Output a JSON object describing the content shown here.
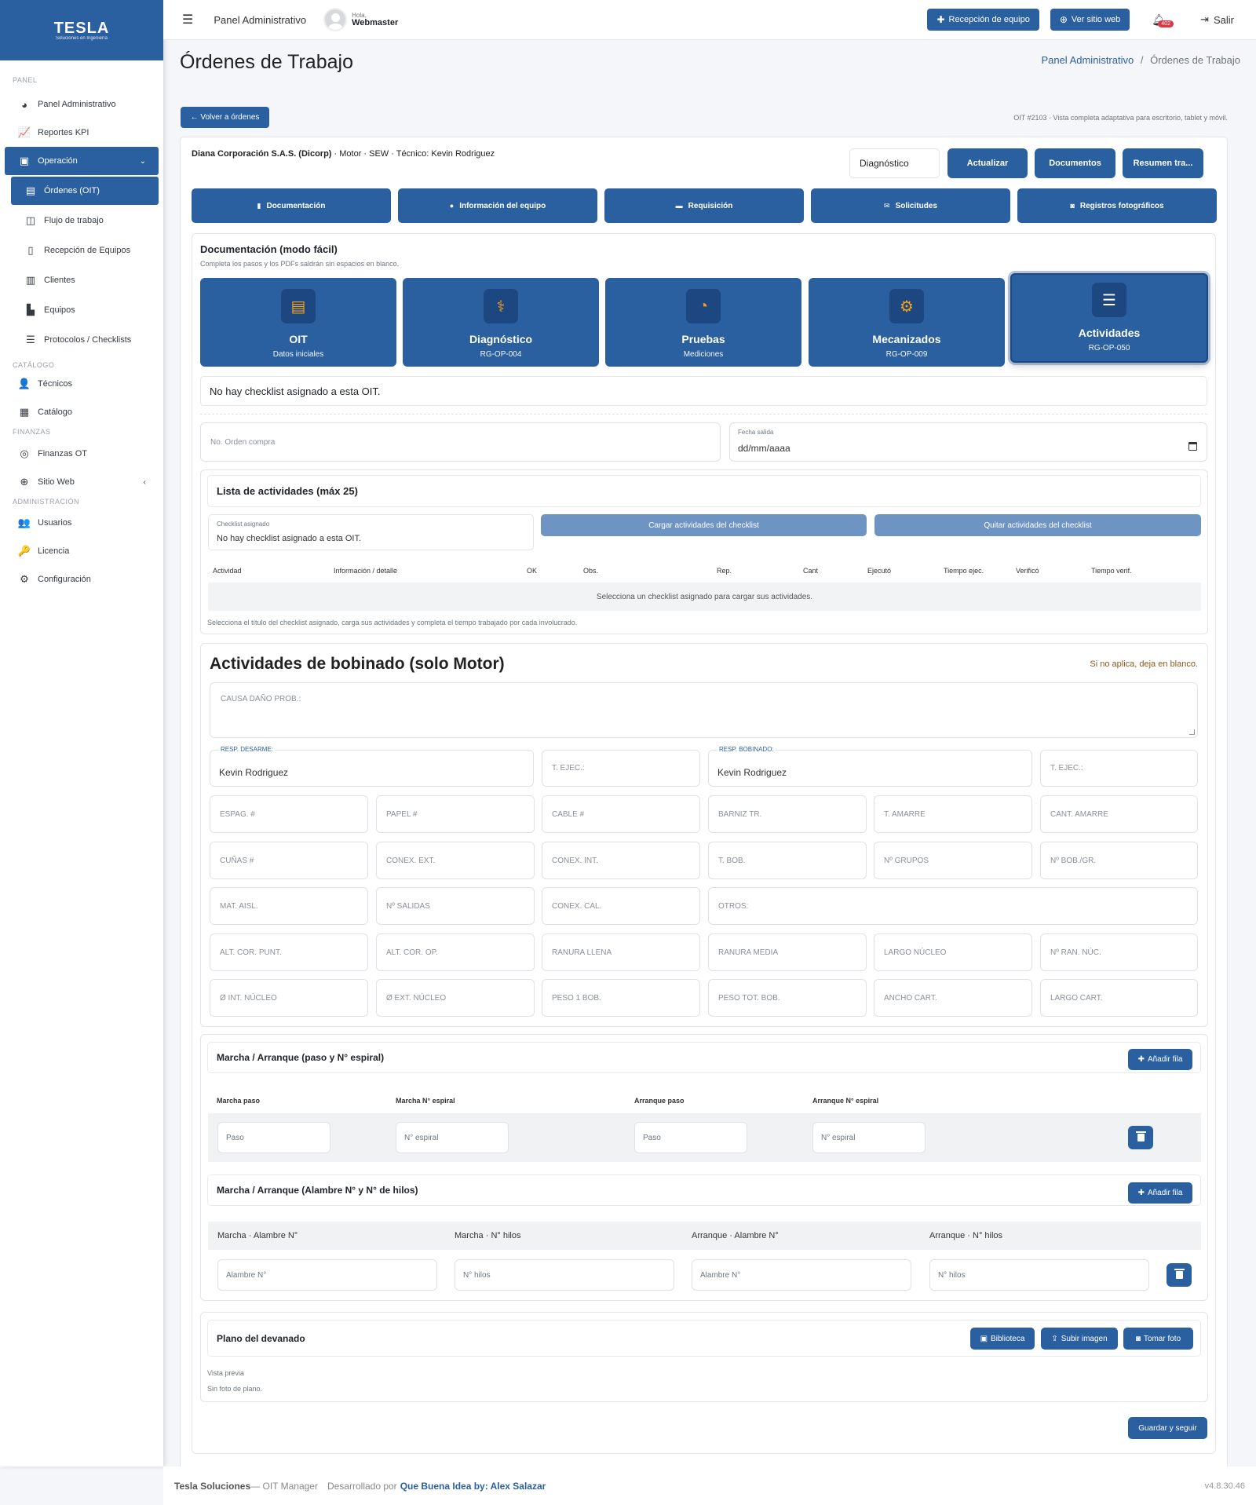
{
  "brand": {
    "name": "TESLA",
    "sub": "Soluciones en Ingeniería",
    "color": "#2a5fa0"
  },
  "sidebar": {
    "sections": [
      "PANEL",
      "CATÁLOGO",
      "FINANZAS",
      "ADMINISTRACIÓN"
    ],
    "panel_items": [
      {
        "label": "Panel Administrativo",
        "icon": "chart-pie-icon"
      },
      {
        "label": "Reportes KPI",
        "icon": "chart-line-icon"
      }
    ],
    "operacion": {
      "label": "Operación",
      "icon": "toolbox-icon"
    },
    "operacion_items": [
      {
        "label": "Órdenes (OIT)",
        "icon": "clipboard-icon"
      },
      {
        "label": "Flujo de trabajo",
        "icon": "columns-icon"
      },
      {
        "label": "Recepción de Equipos",
        "icon": "tablet-icon"
      },
      {
        "label": "Clientes",
        "icon": "building-icon"
      },
      {
        "label": "Equipos",
        "icon": "industry-icon"
      },
      {
        "label": "Protocolos / Checklists",
        "icon": "list-check-icon"
      }
    ],
    "catalogo_items": [
      {
        "label": "Técnicos",
        "icon": "user-cog-icon"
      },
      {
        "label": "Catálogo",
        "icon": "cubes-icon"
      }
    ],
    "finanzas_items": [
      {
        "label": "Finanzas OT",
        "icon": "coins-icon"
      },
      {
        "label": "Sitio Web",
        "icon": "globe-icon"
      }
    ],
    "admin_items": [
      {
        "label": "Usuarios",
        "icon": "users-icon"
      },
      {
        "label": "Licencia",
        "icon": "key-icon"
      },
      {
        "label": "Configuración",
        "icon": "gear-icon"
      }
    ]
  },
  "topbar": {
    "panel_label": "Panel Administrativo",
    "greeting": "Hola,",
    "user": "Webmaster",
    "recepcion_btn": "Recepción de equipo",
    "sitio_btn": "Ver sitio web",
    "notif_count": "402",
    "logout": "Salir"
  },
  "page": {
    "title": "Órdenes de Trabajo",
    "breadcrumb_link": "Panel Administrativo",
    "breadcrumb_sep": "/",
    "breadcrumb_current": "Órdenes de Trabajo",
    "back_btn": "← Volver a órdenes",
    "meta_note": "OIT #2103 · Vista completa adaptativa para escritorio, tablet y móvil."
  },
  "order": {
    "client": "Diana Corporación S.A.S. (Dicorp)",
    "details": " · Motor · SEW · Técnico: Kevin Rodriguez",
    "status": "Diagnóstico",
    "actions": [
      "Actualizar",
      "Documentos",
      "Resumen tra..."
    ]
  },
  "tabs": [
    {
      "label": "Documentación",
      "icon": "file-icon"
    },
    {
      "label": "Información del equipo",
      "icon": "info-icon"
    },
    {
      "label": "Requisición",
      "icon": "receipt-icon"
    },
    {
      "label": "Solicitudes",
      "icon": "envelope-icon"
    },
    {
      "label": "Registros fotográficos",
      "icon": "camera-icon"
    }
  ],
  "doc": {
    "title": "Documentación (modo fácil)",
    "subtitle": "Completa los pasos y los PDFs saldrán sin espacios en blanco.",
    "steps": [
      {
        "name": "OIT",
        "code": "Datos iniciales",
        "icon": "clipboard-icon"
      },
      {
        "name": "Diagnóstico",
        "code": "RG-OP-004",
        "icon": "stethoscope-icon"
      },
      {
        "name": "Pruebas",
        "code": "Mediciones",
        "icon": "gauge-icon"
      },
      {
        "name": "Mecanizados",
        "code": "RG-OP-009",
        "icon": "cogs-icon"
      },
      {
        "name": "Actividades",
        "code": "RG-OP-050",
        "icon": "list-check-icon"
      }
    ],
    "no_checklist": "No hay checklist asignado a esta OIT.",
    "purchase_placeholder": "No. Orden compra",
    "fecha_label": "Fecha salida",
    "fecha_value": "dd/mm/aaaa"
  },
  "activities": {
    "title": "Lista de actividades (máx 25)",
    "checklist_label": "Checklist asignado",
    "checklist_value": "No hay checklist asignado a esta OIT.",
    "load_btn": "Cargar actividades del checklist",
    "remove_btn": "Quitar actividades del checklist",
    "columns": [
      "Actividad",
      "Información / detalle",
      "OK",
      "Obs.",
      "Rep.",
      "Cant",
      "Ejecutó",
      "Tiempo ejec.",
      "Verificó",
      "Tiempo verif."
    ],
    "empty": "Selecciona un checklist asignado para cargar sus actividades.",
    "note": "Selecciona el título del checklist asignado, carga sus actividades y completa el tiempo trabajado por cada involucrado."
  },
  "bobinado": {
    "title": "Actividades de bobinado (solo Motor)",
    "note": "Si no aplica, deja en blanco.",
    "causa": "CAUSA DAÑO PROB.:",
    "resp_desarme_label": "RESP. DESARME:",
    "resp_desarme_value": "Kevin Rodriguez",
    "t_ejec_1": "T. EJEC.:",
    "resp_bobinado_label": "RESP. BOBINADO:",
    "resp_bobinado_value": "Kevin Rodriguez",
    "t_ejec_2": "T. EJEC.:",
    "rows": [
      [
        "ESPAG. #",
        "PAPEL #",
        "CABLE #",
        "BARNIZ TR.",
        "T. AMARRE",
        "CANT. AMARRE"
      ],
      [
        "CUÑAS #",
        "CONEX. EXT.",
        "CONEX. INT.",
        "T. BOB.",
        "Nº GRUPOS",
        "Nº BOB./GR."
      ],
      [
        "MAT. AISL.",
        "Nº SALIDAS",
        "CONEX. CAL.",
        "OTROS:"
      ],
      [
        "ALT. COR. PUNT.",
        "ALT. COR. OP.",
        "RANURA LLENA",
        "RANURA MEDIA",
        "LARGO NÚCLEO",
        "Nº RAN. NÚC."
      ],
      [
        "Ø INT. NÚCLEO",
        "Ø EXT. NÚCLEO",
        "PESO 1 BOB.",
        "PESO TOT. BOB.",
        "ANCHO CART.",
        "LARGO CART."
      ]
    ]
  },
  "marcha1": {
    "title": "Marcha / Arranque (paso y N° espiral)",
    "add": "Añadir fila",
    "columns": [
      "Marcha paso",
      "Marcha N° espiral",
      "Arranque paso",
      "Arranque N° espiral"
    ],
    "placeholders": [
      "Paso",
      "N° espiral",
      "Paso",
      "N° espiral"
    ]
  },
  "marcha2": {
    "title": "Marcha / Arranque (Alambre N° y N° de hilos)",
    "add": "Añadir fila",
    "columns": [
      "Marcha · Alambre N°",
      "Marcha · N° hilos",
      "Arranque · Alambre N°",
      "Arranque · N° hilos"
    ],
    "placeholders": [
      "Alambre N°",
      "N° hilos",
      "Alambre N°",
      "N° hilos"
    ]
  },
  "plano": {
    "title": "Plano del devanado",
    "biblioteca": "Biblioteca",
    "subir": "Subir imagen",
    "foto": "Tomar foto",
    "preview": "Vista previa",
    "no_photo": "Sin foto de plano."
  },
  "save_btn": "Guardar y seguir",
  "footer": {
    "brand": "Tesla Soluciones",
    "app": " — OIT Manager",
    "dev": "Desarrollado por",
    "link": "Que Buena Idea by: Alex Salazar",
    "version": "v4.8.30.46"
  }
}
